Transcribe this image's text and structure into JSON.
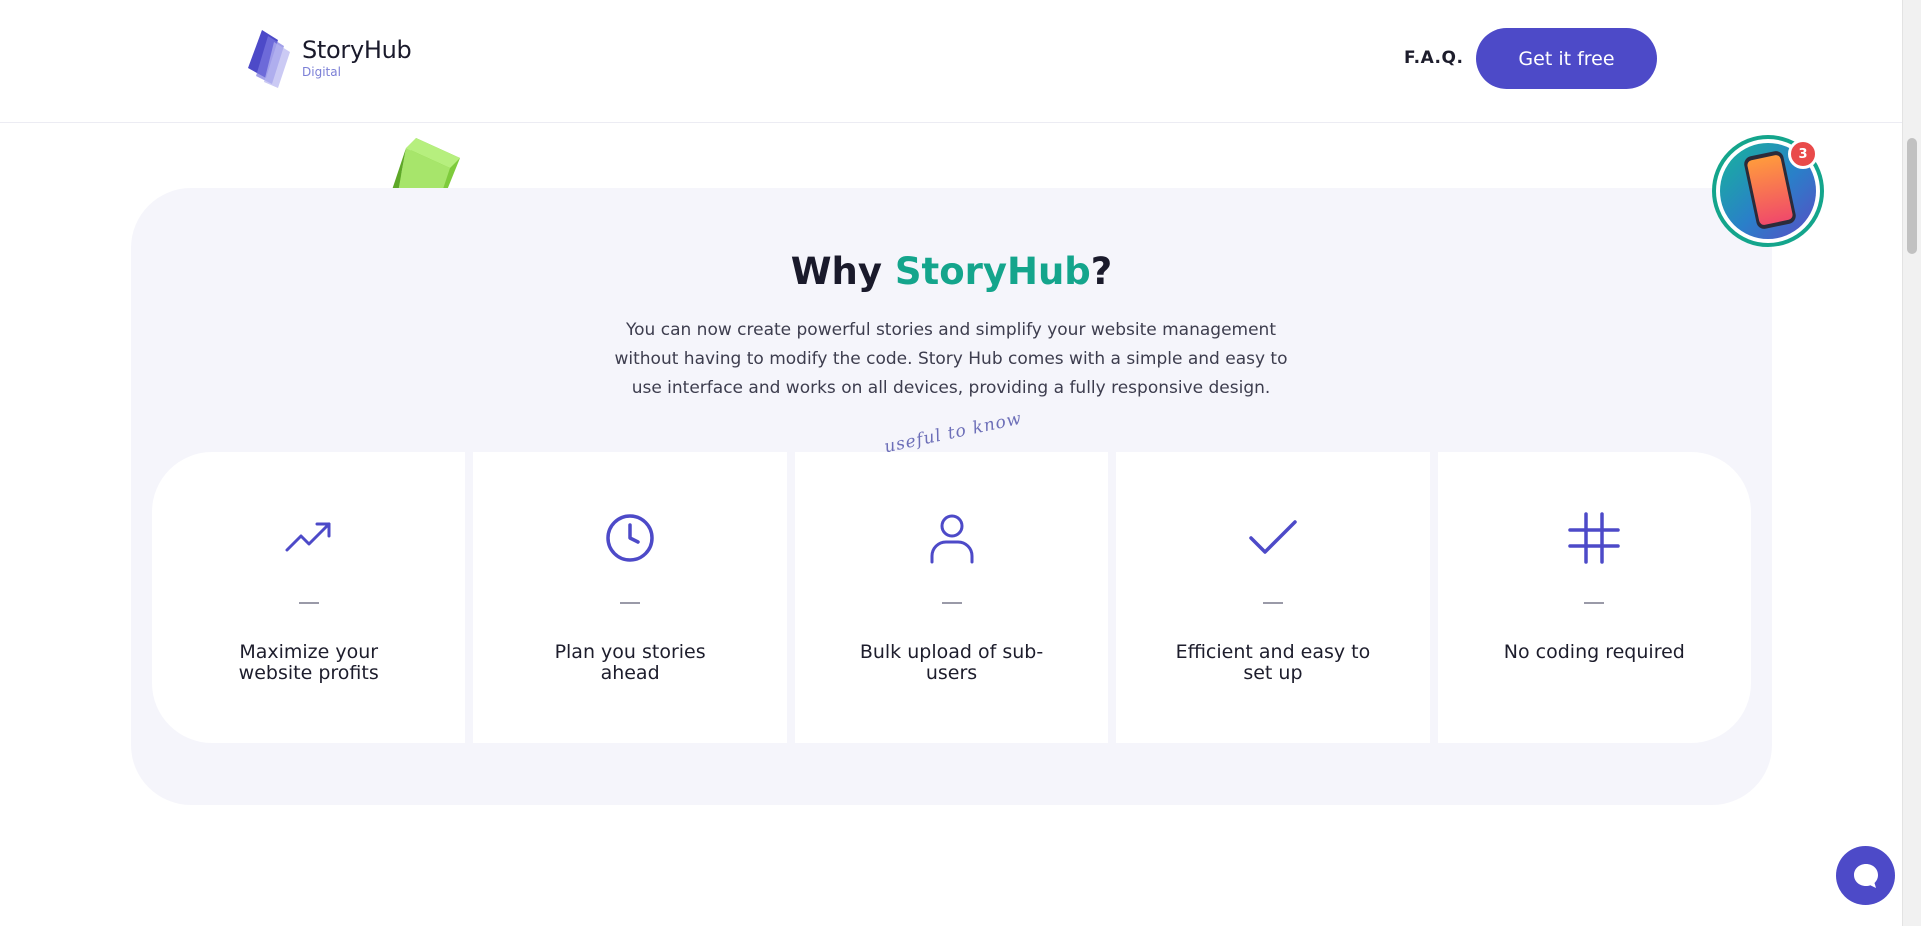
{
  "header": {
    "logo_title": "StoryHub",
    "logo_subtitle": "Digital",
    "faq_label": "F.A.Q.",
    "cta_label": "Get it free"
  },
  "section": {
    "title_prefix": "Why ",
    "title_brand": "StoryHub",
    "title_suffix": "?",
    "description": "You can now create powerful stories and simplify your website management without having to modify the code. Story Hub comes with a simple and easy to use interface and works on all devices, providing a fully responsive design.",
    "handwritten_note": "useful to know",
    "features": [
      {
        "icon": "trending-up-icon",
        "label": "Maximize your website profits"
      },
      {
        "icon": "clock-icon",
        "label": "Plan you stories ahead"
      },
      {
        "icon": "user-icon",
        "label": "Bulk upload of sub-users"
      },
      {
        "icon": "check-icon",
        "label": "Efficient and easy to set up"
      },
      {
        "icon": "hash-icon",
        "label": "No coding required"
      }
    ]
  },
  "story_widget": {
    "badge_count": "3"
  },
  "colors": {
    "primary": "#4d4ac8",
    "brand_green": "#14a58c",
    "section_bg": "#f5f5fb",
    "badge_red": "#e94a4a"
  }
}
